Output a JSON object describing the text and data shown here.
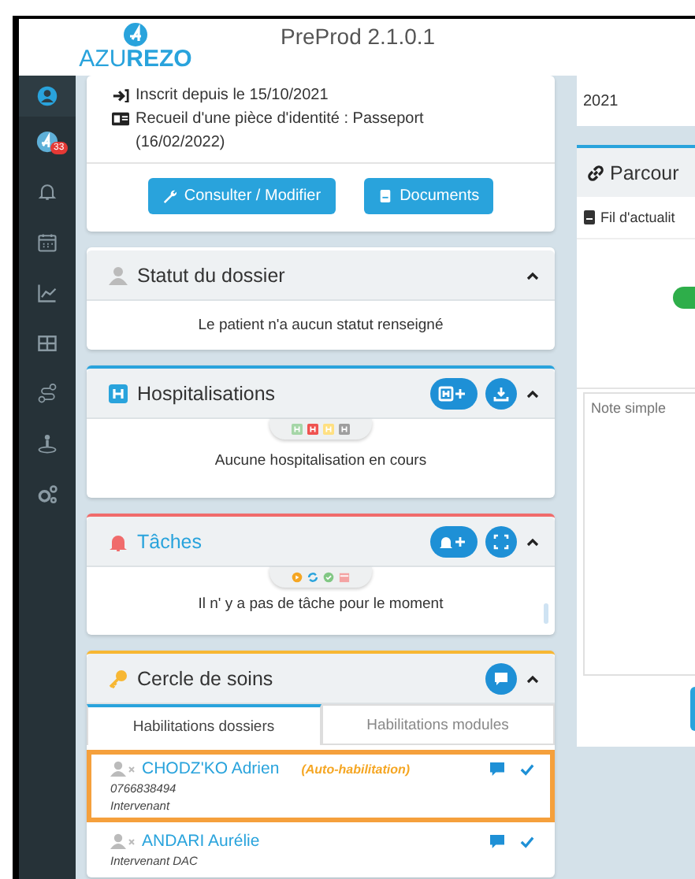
{
  "header": {
    "logo": "AZU**REZO**",
    "title": "PreProd 2.1.0.1"
  },
  "sidebar": {
    "items": [
      {
        "kind": "user",
        "selected": true
      },
      {
        "kind": "avatar",
        "badge": "33",
        "selected": false
      },
      {
        "kind": "bell",
        "selected": false
      },
      {
        "kind": "calendar",
        "selected": false
      },
      {
        "kind": "chart",
        "selected": false
      },
      {
        "kind": "table",
        "selected": false
      },
      {
        "kind": "route",
        "selected": false
      },
      {
        "kind": "person-pin",
        "selected": false
      },
      {
        "kind": "gears",
        "selected": false
      }
    ]
  },
  "patient_card": {
    "lines": [
      {
        "kind": "sign-in",
        "text": "Inscrit depuis le 15/10/2021"
      },
      {
        "kind": "id-card",
        "text": "Recueil d'une pièce d'identité : Passeport (16/02/2022)"
      }
    ],
    "buttons": [
      {
        "kind": "edit",
        "label": "Consulter / Modifier"
      },
      {
        "kind": "documents",
        "label": "Documents"
      }
    ]
  },
  "panels": [
    {
      "kind": "status",
      "title": "Statut du dossier",
      "expanded": true,
      "message": "Le patient n'a aucun statut renseigné"
    },
    {
      "kind": "hospitalisations",
      "title": "Hospitalisations",
      "color": "#29a3dc",
      "expanded": true,
      "actions": [
        {
          "kind": "hospital-add"
        },
        {
          "kind": "download"
        }
      ],
      "legend": [
        {
          "kind": "h",
          "color": "#a5d6a7"
        },
        {
          "kind": "h",
          "color": "#ef5350"
        },
        {
          "kind": "h",
          "color": "#ffe082"
        },
        {
          "kind": "h",
          "color": "#9e9e9e"
        }
      ],
      "message": "Aucune hospitalisation en cours"
    },
    {
      "kind": "tasks",
      "title": "Tâches",
      "color": "#f06b6b",
      "expanded": true,
      "actions": [
        {
          "kind": "bell-add"
        },
        {
          "kind": "expand"
        }
      ],
      "legend": [
        {
          "kind": "play",
          "color": "#f5a623"
        },
        {
          "kind": "sync",
          "color": "#29a3dc"
        },
        {
          "kind": "check",
          "color": "#81c784"
        },
        {
          "kind": "calendar",
          "color": "#f4a3a3"
        }
      ],
      "message": "Il n' y a pas de tâche pour le moment"
    },
    {
      "kind": "care",
      "title": "Cercle de soins",
      "color": "#f7b733",
      "expanded": true,
      "actions": [
        {
          "kind": "comment"
        }
      ],
      "tabs": [
        {
          "label": "Habilitations dossiers",
          "selected": true
        },
        {
          "label": "Habilitations modules",
          "selected": false
        }
      ],
      "members": [
        {
          "name": "CHODZ'KO Adrien",
          "note": "(Auto-habilitation)",
          "phone": "0766838494",
          "role": "Intervenant",
          "selected": true,
          "checked": true
        },
        {
          "name": "ANDARI Aurélie",
          "role": "Intervenant DAC",
          "selected": false,
          "checked": true
        }
      ]
    }
  ],
  "right": {
    "year": "2021",
    "parcours": {
      "title": "Parcour",
      "tab": "Fil d'actualit",
      "toggle_on": true,
      "note_placeholder": "Note simple"
    }
  }
}
